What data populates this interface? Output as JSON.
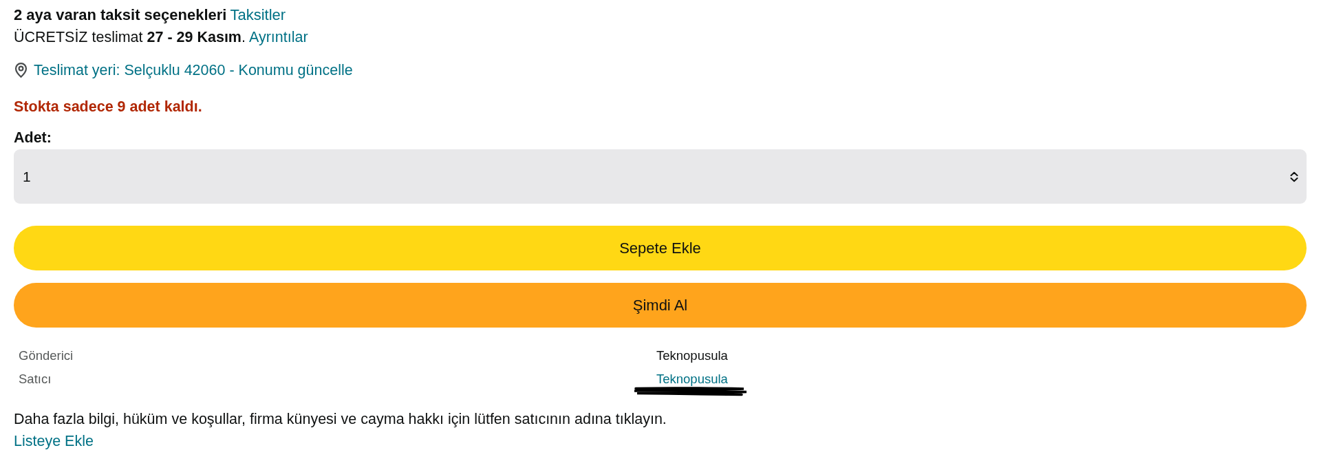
{
  "installments": {
    "text": "2 aya varan taksit seçenekleri",
    "link": "Taksitler"
  },
  "delivery": {
    "text": "ÜCRETSİZ teslimat **27 - 29 Kasım**.",
    "link": "Ayrıntılar"
  },
  "location": {
    "link": "Teslimat yeri: Selçuklu 42060 - Konumu güncelle"
  },
  "stock_notice": "Stokta sadece 9 adet kaldı.",
  "quantity": {
    "label": "Adet:",
    "value": "1"
  },
  "buttons": [
    {
      "kind": "cart",
      "label": "Sepete Ekle"
    },
    {
      "kind": "buy",
      "label": "Şimdi Al"
    }
  ],
  "seller_info": [
    {
      "label": "Gönderici",
      "value": "Teknopusula",
      "kind": "text"
    },
    {
      "label": "Satıcı",
      "value": "Teknopusula",
      "kind": "link"
    }
  ],
  "info_text": "Daha fazla bilgi, hüküm ve koşullar, firma künyesi ve cayma hakkı için lütfen satıcının adına tıklayın.",
  "add_to_list": "Listeye Ekle"
}
